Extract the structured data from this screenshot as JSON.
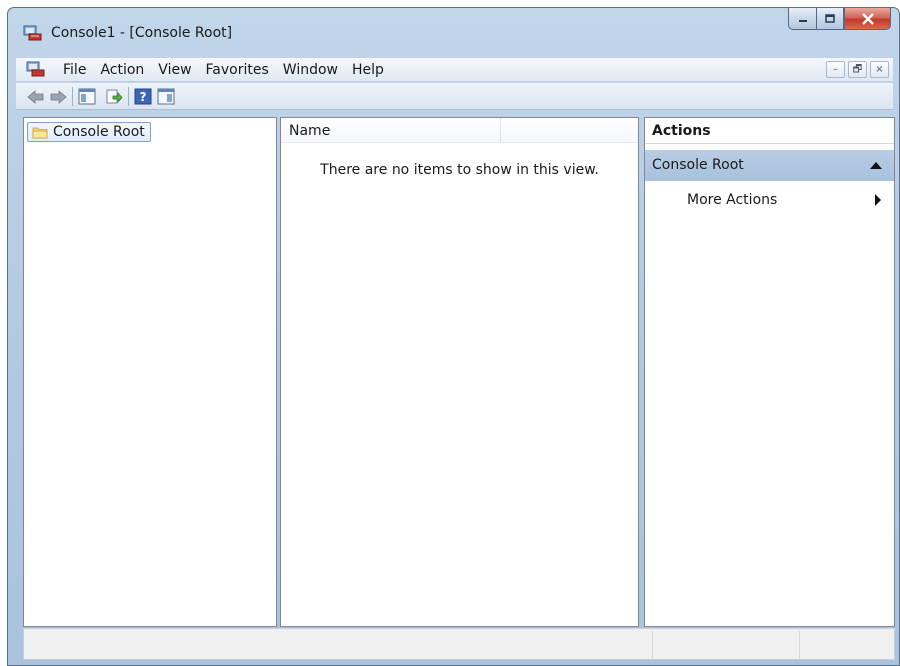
{
  "window": {
    "title": "Console1 - [Console Root]",
    "caption_buttons": [
      "minimize",
      "maximize",
      "close"
    ]
  },
  "menubar": {
    "items": [
      "File",
      "Action",
      "View",
      "Favorites",
      "Window",
      "Help"
    ],
    "mdi_buttons": {
      "minimize": "–",
      "restore": "🗗",
      "close": "×"
    }
  },
  "toolbar": {
    "buttons": [
      "back-arrow-icon",
      "forward-arrow-icon",
      "show-hide-console-tree-icon",
      "export-list-icon",
      "help-icon",
      "show-hide-action-pane-icon"
    ]
  },
  "tree": {
    "nodes": [
      {
        "label": "Console Root",
        "icon": "folder-icon"
      }
    ]
  },
  "list": {
    "columns": [
      "Name"
    ],
    "empty_message": "There are no items to show in this view."
  },
  "actions": {
    "header": "Actions",
    "group": "Console Root",
    "items": [
      {
        "label": "More Actions"
      }
    ]
  },
  "colors": {
    "frame": "#b3cae3",
    "actions_group_bg": "#b0c7e0",
    "close_button": "#c9473a"
  }
}
